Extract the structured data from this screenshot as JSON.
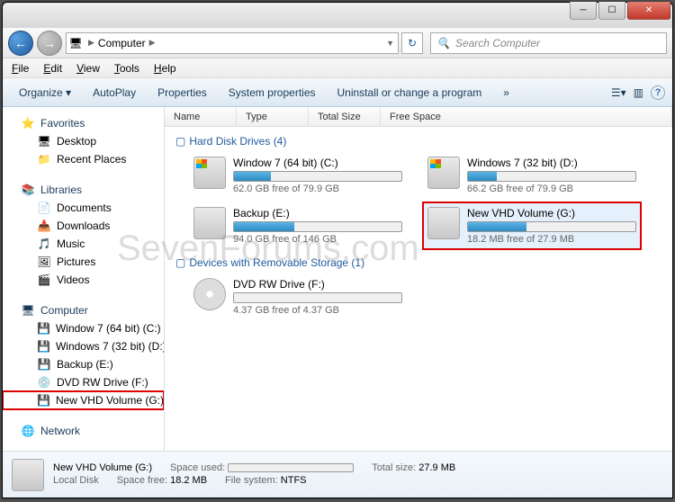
{
  "titlebar": {
    "min_label": "─",
    "max_label": "☐",
    "close_label": "✕"
  },
  "nav": {
    "back_glyph": "←",
    "fwd_glyph": "→",
    "breadcrumb_root": "Computer",
    "refresh_glyph": "↻",
    "search_placeholder": "Search Computer",
    "search_glyph": "🔍"
  },
  "menus": [
    "File",
    "Edit",
    "View",
    "Tools",
    "Help"
  ],
  "toolbar": {
    "organize": "Organize ▾",
    "autoplay": "AutoPlay",
    "properties": "Properties",
    "sysprops": "System properties",
    "uninstall": "Uninstall or change a program",
    "more": "»",
    "view_glyph": "☰▾",
    "pane_glyph": "▥",
    "help_glyph": "?"
  },
  "columns": [
    "Name",
    "Type",
    "Total Size",
    "Free Space"
  ],
  "sidebar": {
    "favorites": {
      "label": "Favorites",
      "items": [
        "Desktop",
        "Recent Places"
      ]
    },
    "libraries": {
      "label": "Libraries",
      "items": [
        "Documents",
        "Downloads",
        "Music",
        "Pictures",
        "Videos"
      ]
    },
    "computer": {
      "label": "Computer",
      "items": [
        "Window 7 (64 bit) (C:)",
        "Windows 7 (32 bit) (D:)",
        "Backup (E:)",
        "DVD RW Drive (F:)",
        "New VHD Volume (G:)"
      ]
    },
    "network": {
      "label": "Network"
    }
  },
  "sections": {
    "hdd": {
      "label": "Hard Disk Drives (4)"
    },
    "rem": {
      "label": "Devices with Removable Storage (1)"
    }
  },
  "drives": {
    "c": {
      "name": "Window 7 (64 bit) (C:)",
      "free": "62.0 GB free of 79.9 GB",
      "fill_pct": 22
    },
    "d": {
      "name": "Windows 7 (32 bit) (D:)",
      "free": "66.2 GB free of 79.9 GB",
      "fill_pct": 17
    },
    "e": {
      "name": "Backup (E:)",
      "free": "94.0 GB free of 146 GB",
      "fill_pct": 36
    },
    "g": {
      "name": "New VHD Volume (G:)",
      "free": "18.2 MB free of 27.9 MB",
      "fill_pct": 35
    },
    "f": {
      "name": "DVD RW Drive (F:)",
      "free": "4.37 GB free of 4.37 GB"
    }
  },
  "status": {
    "title": "New VHD Volume (G:)",
    "sub": "Local Disk",
    "used_lbl": "Space used:",
    "total_lbl": "Total size:",
    "total_val": "27.9 MB",
    "free_lbl": "Space free:",
    "free_val": "18.2 MB",
    "fs_lbl": "File system:",
    "fs_val": "NTFS"
  },
  "watermark": "SevenForums.com"
}
